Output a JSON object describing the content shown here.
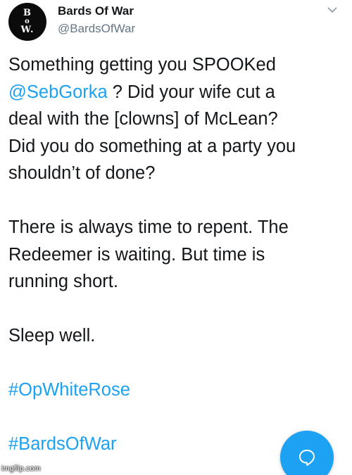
{
  "author": {
    "display_name": "Bards Of War",
    "handle": "@BardsOfWar",
    "avatar_letters": [
      "B",
      "o",
      "W."
    ]
  },
  "tweet": {
    "line1": "Something getting you SPOOKed",
    "mention": "@SebGorka",
    "line2_rest": " ? Did your wife cut a",
    "line3": "deal with the [clowns] of McLean?",
    "line4": "Did you do something at a party you",
    "line5": "shouldn’t of done?",
    "line6": "There is always time to repent. The",
    "line7": "Redeemer is waiting. But time is",
    "line8": "running short.",
    "line9": "Sleep well.",
    "hashtag1": "#OpWhiteRose",
    "hashtag2": "#BardsOfWar"
  },
  "watermark": "imgflip.com",
  "icons": {
    "more": "chevron-down-icon",
    "compose": "chat-bubble-icon"
  },
  "colors": {
    "link": "#1da1f2",
    "text": "#14171a",
    "secondary": "#657786",
    "fab": "#1da1f2"
  }
}
